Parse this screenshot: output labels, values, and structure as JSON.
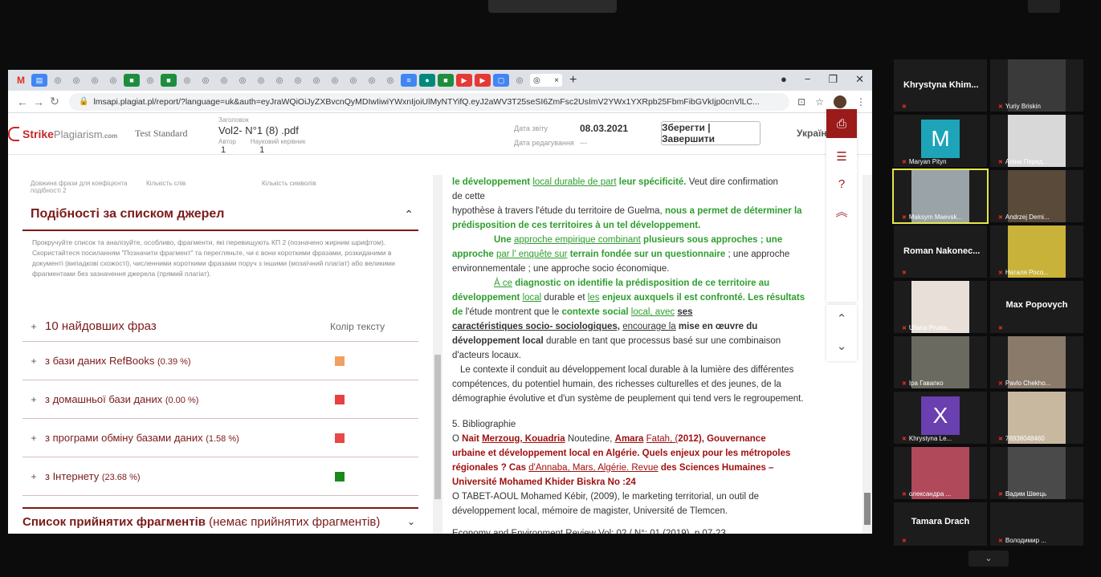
{
  "browser": {
    "tab_gmail_glyph": "M",
    "active_tab_close": "×",
    "new_tab_glyph": "+",
    "win_minimize": "−",
    "win_restore": "❐",
    "win_close": "✕",
    "url": "lmsapi.plagiat.pl/report/?language=uk&auth=eyJraWQiOiJyZXBvcnQyMDIwIiwiYWxnIjoiUlMyNTYifQ.eyJ2aWV3T25seSI6ZmFsc2UsImV2YWx1YXRpb25FbmFibGVkIjp0cnVlLC..."
  },
  "header": {
    "logo_main": "Strike",
    "logo_second": "Plagiarism",
    "logo_suffix": ".com",
    "plan": "Test Standard",
    "title_label": "Заголовок",
    "doc_title": "Vol2- N°1 (8) .pdf",
    "author_label": "Автор",
    "supervisor_label": "Науковий керівник",
    "author_value": "1",
    "supervisor_value": "1",
    "report_date_label": "Дата звіту",
    "report_date": "08.03.2021",
    "edit_date_label": "Дата редагування",
    "edit_date": "---",
    "save_button": "Зберегти | Завершити",
    "language": "Українська ▾"
  },
  "left": {
    "len_labels": [
      "Довжина фрази для коефіцієнта подібності 2",
      "Кількість слів",
      "Кількість символів"
    ],
    "similarity_title": "Подібності за списком джерел",
    "similarity_desc": "Прокручуйте список та аналізуйте, особливо, фрагменти, які перевищують КП 2 (позначено жирним шрифтом). Скористайтеся посиланням \"Позначити фрагмент\" та перегляньте, чи є вони короткими фразами, розкиданими в документі (випадкові схожості), численними короткими фразами поруч з іншими (мозаїчний плагіат) або великими фрагментами без зазначення джерела (прямий плагіат).",
    "top_phrases": "10 найдовших фраз",
    "text_color_label": "Колір тексту",
    "sources": [
      {
        "label": "з бази даних RefBooks",
        "pct": "(0.39 %)",
        "color": "#f0a060"
      },
      {
        "label": "з домашньої бази даних",
        "pct": "(0.00 %)",
        "color": "#e84040"
      },
      {
        "label": "з програми обміну базами даних",
        "pct": "(1.58 %)",
        "color": "#e84848"
      },
      {
        "label": "з Інтернету",
        "pct": "(23.68 %)",
        "color": "#1a8a1a"
      }
    ],
    "accepted_title": "Список прийнятих фрагментів",
    "accepted_note": "(немає прийнятих фрагментів)"
  },
  "text": {
    "l1a": "le développement",
    "l1b": "local durable de part",
    "l1c": "leur spécificité.",
    "l1d": "Veut dire confirmation",
    "l2": "de cette",
    "l3a": "hypothèse à travers l'étude du territoire de Guelma,",
    "l3b": "nous a permet de déterminer la",
    "l4": "prédisposition de ces territoires à un tel développement.",
    "l5a": "Une",
    "l5b": "approche empirique combinant",
    "l5c": "plusieurs sous approches ; une",
    "l6a": "approche",
    "l6b": "par l' enquête sur",
    "l6c": "terrain fondée sur un questionnaire",
    "l6d": "; une approche",
    "l7": "environnementale ; une approche socio économique.",
    "l8a": "À ce",
    "l8b": "diagnostic on identifie la prédisposition de ce territoire au",
    "l9a": "développement",
    "l9b": "local",
    "l9c": "durable et",
    "l9d": "les",
    "l9e": "enjeux auxquels il est confronté. Les résultats",
    "l10a": "de",
    "l10b": "l'étude montrent que le",
    "l10c": "contexte social",
    "l10d": "local, avec",
    "l10e": "ses",
    "l11a": "caractéristiques socio- sociologiques,",
    "l11b": "encourage la",
    "l11c": "mise en œuvre du",
    "l12a": "développement local",
    "l12b": "durable en tant que processus basé sur une combinaison",
    "l13": "d'acteurs locaux.",
    "l14": "Le contexte il conduit au développement local durable à la lumière des différentes",
    "l15": "compétences, du potentiel humain, des richesses culturelles et des jeunes, de la",
    "l16": "démographie évolutive et d'un système de peuplement qui tend vers le regroupement.",
    "biblio": "5. Bibliographie",
    "b1a": "O",
    "b1b": "Nait",
    "b1c": "Merzoug, Kouadria",
    "b1d": "Noutedine,",
    "b1e": "Amara",
    "b1f": "Fatah, (",
    "b1g": "2012), Gouvernance",
    "b2": "urbaine et développement local en Algérie. Quels enjeux pour les métropoles",
    "b3a": "régionales ? Cas",
    "b3b": "d'Annaba, Mars, Algérie. Revue",
    "b3c": "des Sciences Humaines –",
    "b4": "Université Mohamed Khider Biskra No :24",
    "b5": "O TABET-AOUL Mohamed Kébir, (2009), le marketing territorial, un outil de",
    "b6": "développement local, mémoire de magister, Université de Tlemcen.",
    "footer": "Economy and Environment Review Vol: 02 / N°: 01 (2019), p 07-23"
  },
  "participants": [
    {
      "name": "Khrystyna Khim..."
    },
    {
      "name": "Yuriy Briskin"
    },
    {
      "name": "Maryan Pityn",
      "initial": "M",
      "color": "#1ea4b8"
    },
    {
      "name": "Аліна Перед..."
    },
    {
      "name": "Maksym Maevsk..."
    },
    {
      "name": "Andrzej Demi..."
    },
    {
      "name": "Roman Nakonec..."
    },
    {
      "name": "Наталя Росо..."
    },
    {
      "name": "Uliana Prusia..."
    },
    {
      "name": "Max Popovych"
    },
    {
      "name": "Ipa Гавапко"
    },
    {
      "name": "Pavlo Chekho..."
    },
    {
      "name": "Khrystyna Le...",
      "initial": "X",
      "color": "#6a3fb0"
    },
    {
      "name": "76938048460"
    },
    {
      "name": "олександра ..."
    },
    {
      "name": "Вадим Швець"
    },
    {
      "name": "Tamara Drach"
    },
    {
      "name": "Володимир ..."
    }
  ],
  "gallery_chevron": "⌄"
}
